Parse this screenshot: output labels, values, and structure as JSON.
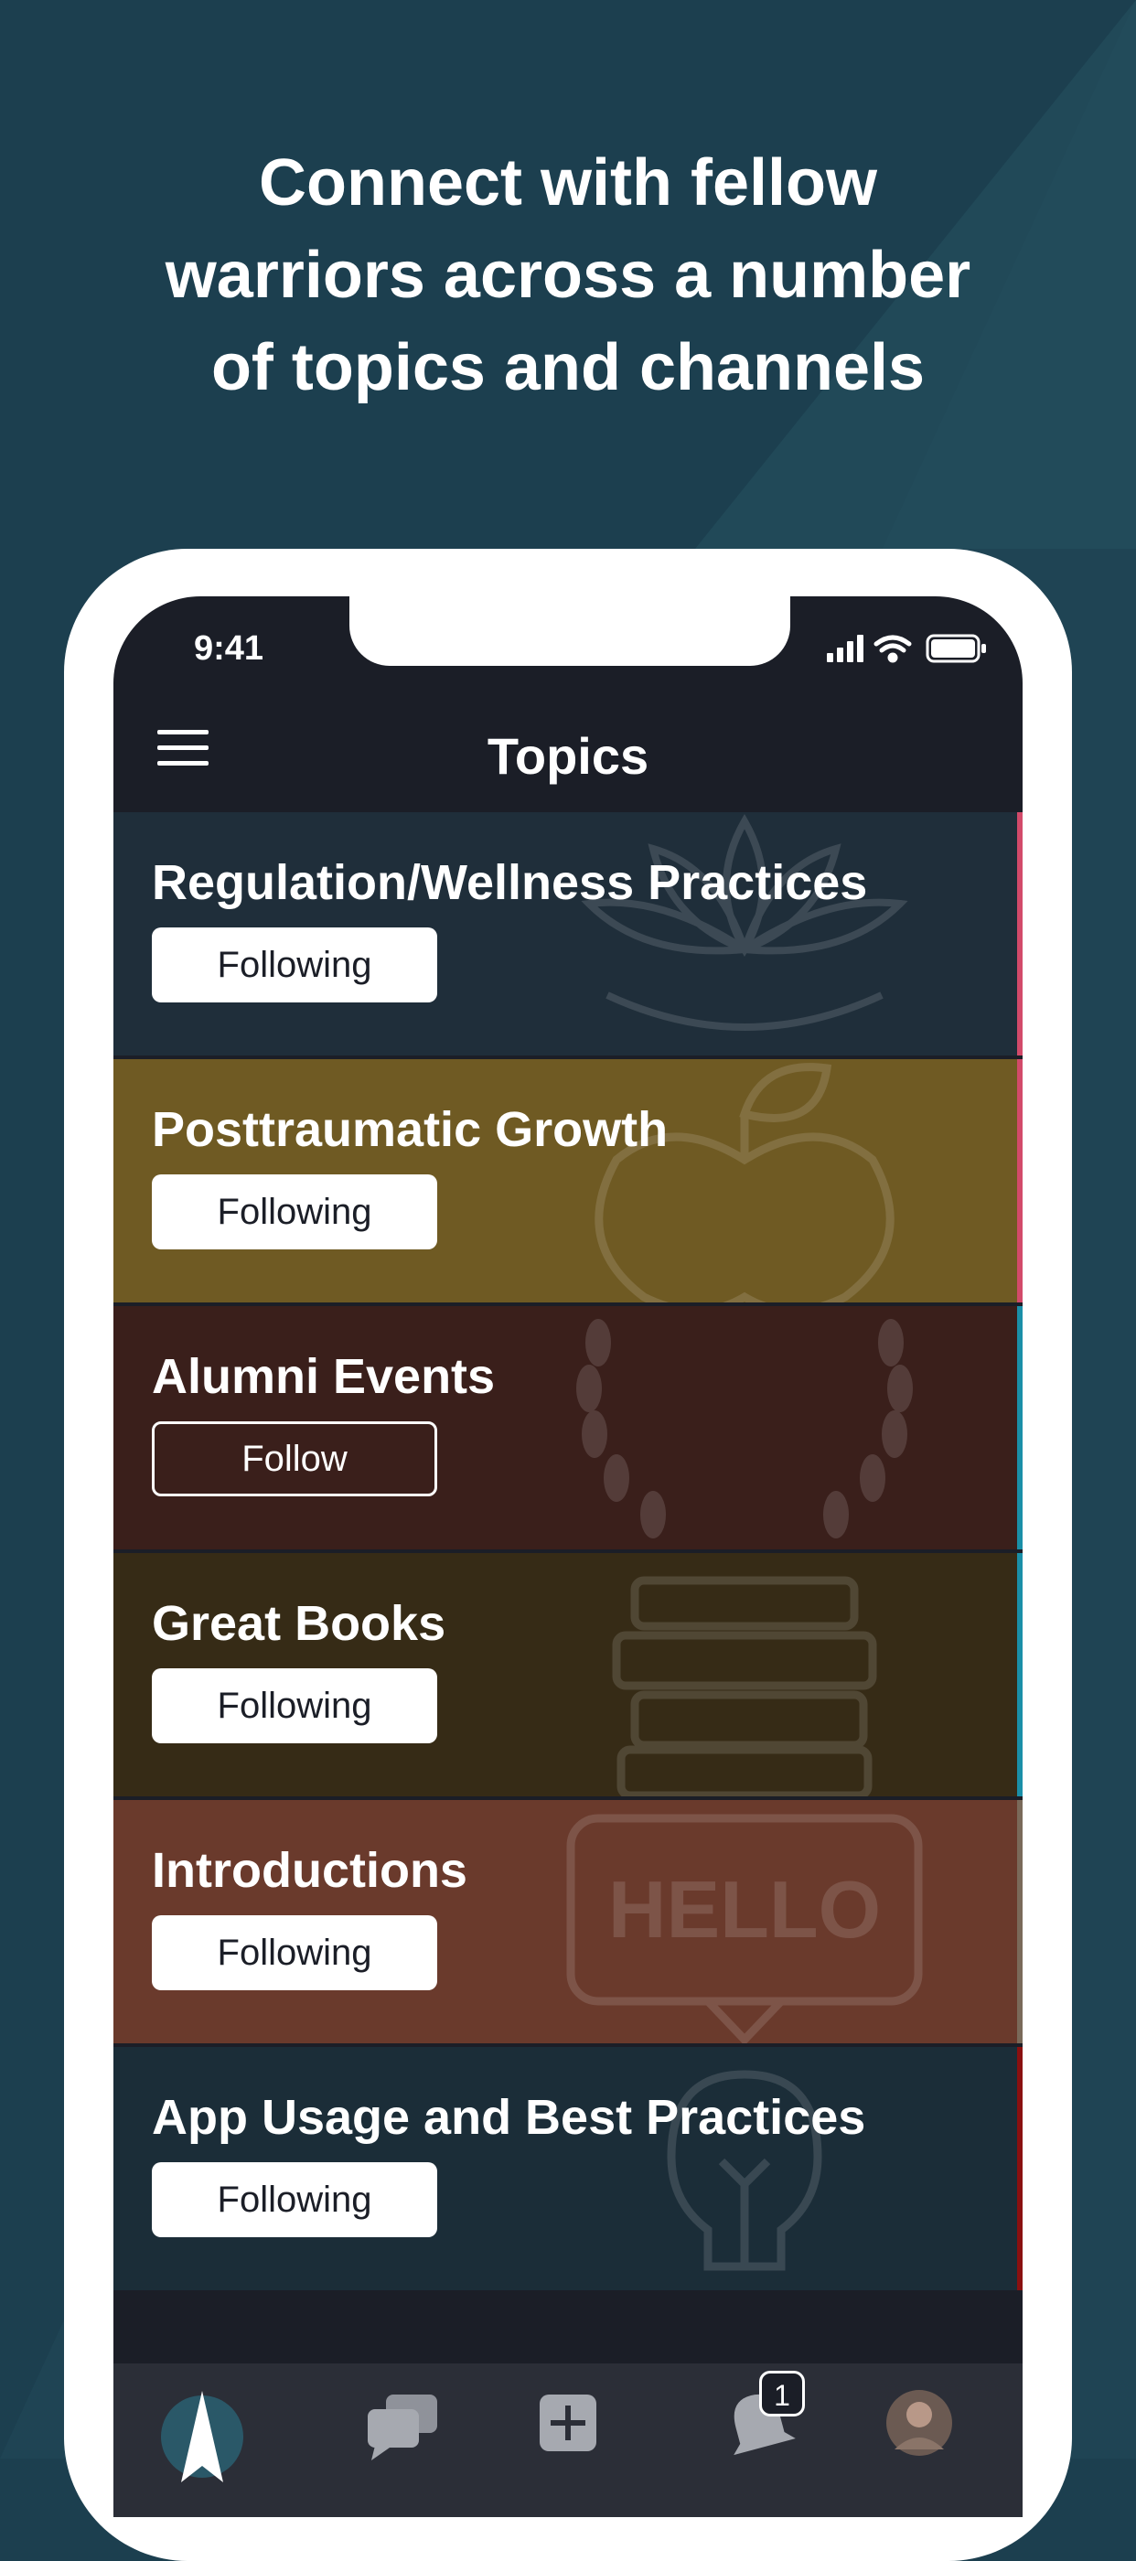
{
  "headline": {
    "line1": "Connect with fellow",
    "line2": "warriors across a number",
    "line3": "of topics and channels"
  },
  "status_bar": {
    "time": "9:41"
  },
  "nav": {
    "title": "Topics",
    "menu_icon": "hamburger-icon"
  },
  "topics": [
    {
      "name": "Regulation/Wellness Practices",
      "button": "Following",
      "state": "following",
      "bg": "#1f2e3a",
      "accent": "#d24a6a",
      "icon": "lotus-icon"
    },
    {
      "name": "Posttraumatic Growth",
      "button": "Following",
      "state": "following",
      "bg": "#6f5a23",
      "accent": "#d24a6a",
      "icon": "apple-sprout-icon"
    },
    {
      "name": "Alumni Events",
      "button": "Follow",
      "state": "not-following",
      "bg": "#3a1f1b",
      "accent": "#1a8fa8",
      "icon": "laurel-wreath-icon"
    },
    {
      "name": "Great Books",
      "button": "Following",
      "state": "following",
      "bg": "#362b16",
      "accent": "#1a8fa8",
      "icon": "book-stack-icon"
    },
    {
      "name": "Introductions",
      "button": "Following",
      "state": "following",
      "bg": "#6a3a2c",
      "accent": "#7a6a5a",
      "icon": "hello-sign-icon",
      "icon_text": "HELLO"
    },
    {
      "name": "App Usage and Best Practices",
      "button": "Following",
      "state": "following",
      "bg": "#1b2d38",
      "accent": "#8a1010",
      "icon": "lightbulb-icon"
    }
  ],
  "tabbar": {
    "tabs": [
      "compass-icon",
      "chat-bubbles-icon",
      "add-post-icon",
      "notifications-bell-icon",
      "profile-avatar"
    ],
    "notification_count": "1"
  },
  "colors": {
    "background": "#1c3f4f",
    "screen": "#1b1e27",
    "tabbar": "#2b2e37"
  }
}
